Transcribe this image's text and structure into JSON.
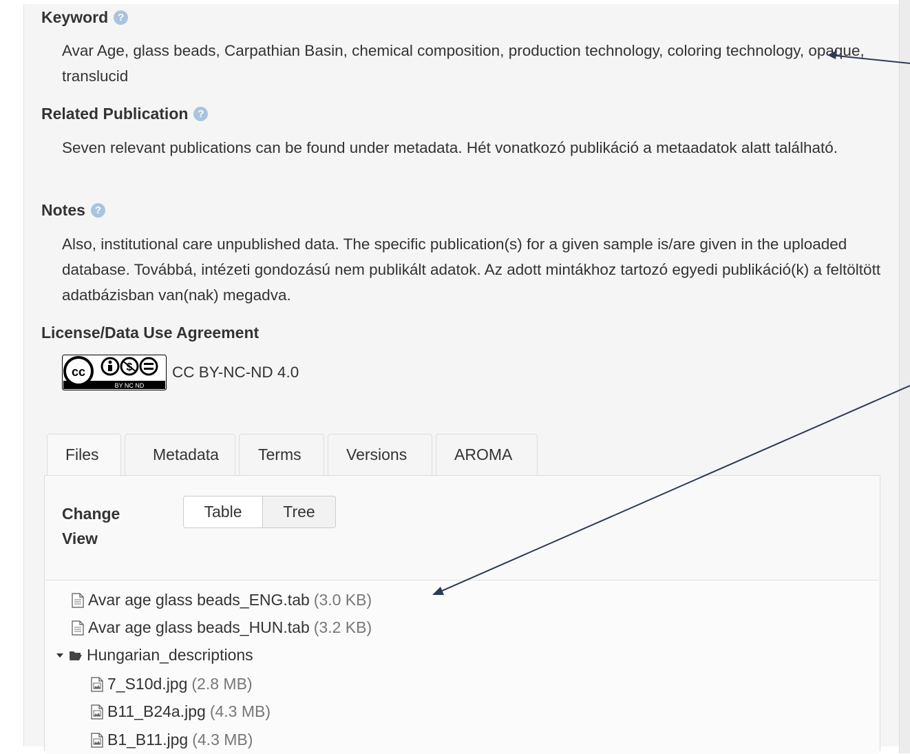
{
  "keyword": {
    "label": "Keyword",
    "value": "Avar Age, glass beads, Carpathian Basin, chemical composition, production technology, coloring technology, opaque, translucid"
  },
  "related_publication": {
    "label": "Related Publication",
    "value": "Seven relevant publications can be found under metadata. Hét vonatkozó publikáció a metaadatok alatt található."
  },
  "notes": {
    "label": "Notes",
    "value": "Also, institutional care unpublished data. The specific publication(s) for a given sample is/are given in the uploaded database. Továbbá, intézeti gondozású nem publikált adatok. Az adott mintákhoz tartozó egyedi publikáció(k) a feltöltött adatbázisban van(nak) megadva."
  },
  "license": {
    "label": "License/Data Use Agreement",
    "badge_text": "BY NC ND",
    "badge_logo": "cc",
    "name": "CC BY-NC-ND 4.0"
  },
  "tabs": [
    "Files",
    "Metadata",
    "Terms",
    "Versions",
    "AROMA"
  ],
  "change_view": {
    "label": "Change View",
    "options": [
      "Table",
      "Tree"
    ],
    "selected": "Tree"
  },
  "files": [
    {
      "name": "Avar age glass beads_ENG.tab",
      "size": "(3.0 KB)",
      "icon": "file-icon"
    },
    {
      "name": "Avar age glass beads_HUN.tab",
      "size": "(3.2 KB)",
      "icon": "file-icon"
    },
    {
      "name": "Hungarian_descriptions",
      "icon": "folder-open-icon",
      "expanded": true,
      "children": [
        {
          "name": "7_S10d.jpg",
          "size": "(2.8 MB)",
          "icon": "image-file-icon"
        },
        {
          "name": "B11_B24a.jpg",
          "size": "(4.3 MB)",
          "icon": "image-file-icon"
        },
        {
          "name": "B1_B11.jpg",
          "size": "(4.3 MB)",
          "icon": "image-file-icon"
        }
      ]
    }
  ],
  "colors": {
    "annotation_arrow": "#2b3a55",
    "help_icon": "#a9c4dd",
    "panel_background": "#f5f5f5"
  }
}
